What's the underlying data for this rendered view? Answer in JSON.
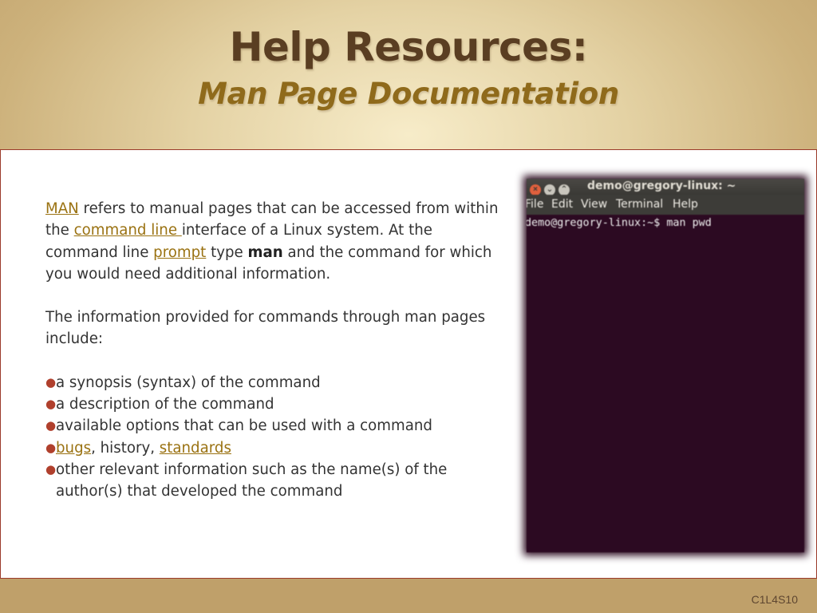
{
  "slide": {
    "title": "Help Resources:",
    "subtitle": "Man Page Documentation",
    "footer_code": "C1L4S10"
  },
  "body": {
    "p1": {
      "link_man": "MAN",
      "t1": " refers to manual pages that can be accessed from within the ",
      "link_command_line": "command line ",
      "t2": "interface of a Linux system. At the command line ",
      "link_prompt": "prompt",
      "t3": " type ",
      "bold_man": "man",
      "t4": " and the command for which you would need additional information."
    },
    "p2": "The information provided for commands through man pages include:",
    "bullets": {
      "b1": "a synopsis (syntax) of the command",
      "b2": "a description of the command",
      "b3": "available options that can be used with a command",
      "b4_link_bugs": "bugs",
      "b4_t1": ", history, ",
      "b4_link_standards": "standards",
      "b5": "other relevant information such as the name(s) of the author(s) that developed the command"
    }
  },
  "terminal": {
    "title": "demo@gregory-linux: ~",
    "menu": [
      "File",
      "Edit",
      "View",
      "Terminal",
      "Help"
    ],
    "prompt_line": "demo@gregory-linux:~$ man pwd"
  },
  "colors": {
    "link": "#9a7212",
    "title": "#5a3e22",
    "subtitle": "#8f6a1b",
    "bullet": "#b0402d",
    "terminal_bg": "#2c0a22"
  },
  "icons": {
    "bullet": "bullet-icon",
    "window_close": "close-icon",
    "window_minimize": "minimize-icon",
    "window_maximize": "maximize-icon"
  }
}
